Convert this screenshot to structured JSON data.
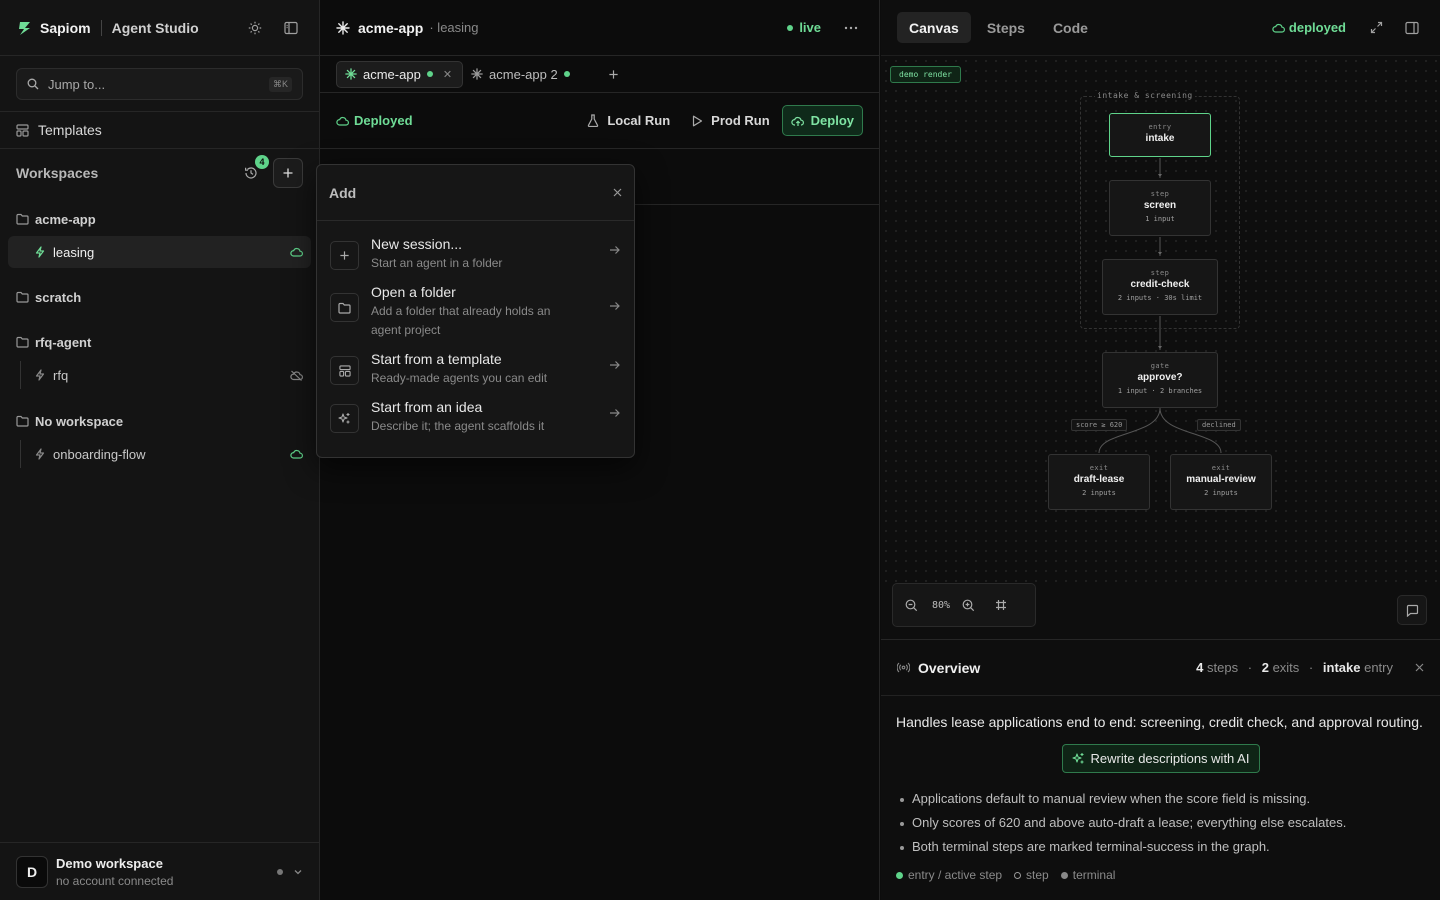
{
  "app": {
    "brand": "Sapiom",
    "product": "Agent Studio"
  },
  "sidebar": {
    "search": {
      "placeholder": "Jump to...",
      "shortcut": "⌘K"
    },
    "templates_label": "Templates",
    "workspaces_label": "Workspaces",
    "history_count": "4",
    "folders": [
      {
        "name": "acme-app",
        "agents": [
          {
            "name": "leasing",
            "status": "deployed"
          }
        ]
      },
      {
        "name": "scratch",
        "agents": []
      },
      {
        "name": "rfq-agent",
        "agents": [
          {
            "name": "rfq",
            "status": "hidden"
          }
        ]
      },
      {
        "name": "No workspace",
        "agents": [
          {
            "name": "onboarding-flow",
            "status": "deployed"
          }
        ]
      }
    ],
    "footer": {
      "avatar": "D",
      "workspace": "Demo workspace",
      "account": "no account connected"
    }
  },
  "center": {
    "header": {
      "title": "acme-app",
      "subtitle": "· leasing",
      "status": "live"
    },
    "tabs": [
      {
        "label": "acme-app"
      },
      {
        "label": "acme-app 2"
      }
    ],
    "toolbar": {
      "deployed": "Deployed",
      "local_run": "Local Run",
      "prod_run": "Prod Run",
      "deploy": "Deploy"
    }
  },
  "popover": {
    "title": "Add",
    "items": [
      {
        "label": "New session...",
        "desc": "Start an agent in a folder",
        "icon": "plus-icon"
      },
      {
        "label": "Open a folder",
        "desc": "Add a folder that already holds an agent project",
        "icon": "folder-icon"
      },
      {
        "label": "Start from a template",
        "desc": "Ready-made agents you can edit",
        "icon": "template-icon"
      },
      {
        "label": "Start from an idea",
        "desc": "Describe it; the agent scaffolds it",
        "icon": "sparkles-icon"
      }
    ]
  },
  "right": {
    "tabs": [
      "Canvas",
      "Steps",
      "Code"
    ],
    "active_tab": "Canvas",
    "deployed": "deployed",
    "canvas": {
      "badge": "demo render",
      "group": "intake & screening",
      "nodes": [
        {
          "kind": "entry",
          "name": "intake",
          "meta": ""
        },
        {
          "kind": "step",
          "name": "screen",
          "meta": "1 input"
        },
        {
          "kind": "step",
          "name": "credit-check",
          "meta": "2 inputs · 30s limit"
        },
        {
          "kind": "gate",
          "name": "approve?",
          "meta": "1 input · 2 branches"
        },
        {
          "kind": "exit",
          "name": "draft-lease",
          "meta": "2 inputs"
        },
        {
          "kind": "exit",
          "name": "manual-review",
          "meta": "2 inputs"
        }
      ],
      "edges": [
        "score ≥ 620",
        "declined"
      ],
      "zoom": "80%"
    },
    "overview": {
      "title": "Overview",
      "steps_count": "4",
      "steps_label": "steps",
      "exits_count": "2",
      "exits_label": "exits",
      "entry_name": "intake",
      "entry_label": "entry",
      "description": "Handles lease applications end to end: screening, credit check, and approval routing.",
      "ai_button": "Rewrite descriptions with AI",
      "bullets": [
        "Applications default to manual review when the score field is missing.",
        "Only scores of 620 and above auto-draft a lease; everything else escalates.",
        "Both terminal steps are marked terminal-success in the graph."
      ],
      "legend": [
        "entry / active step",
        "step",
        "terminal"
      ]
    }
  },
  "colors": {
    "accent": "#5fd38a",
    "background": "#0c0c0c",
    "panel": "#141414"
  }
}
